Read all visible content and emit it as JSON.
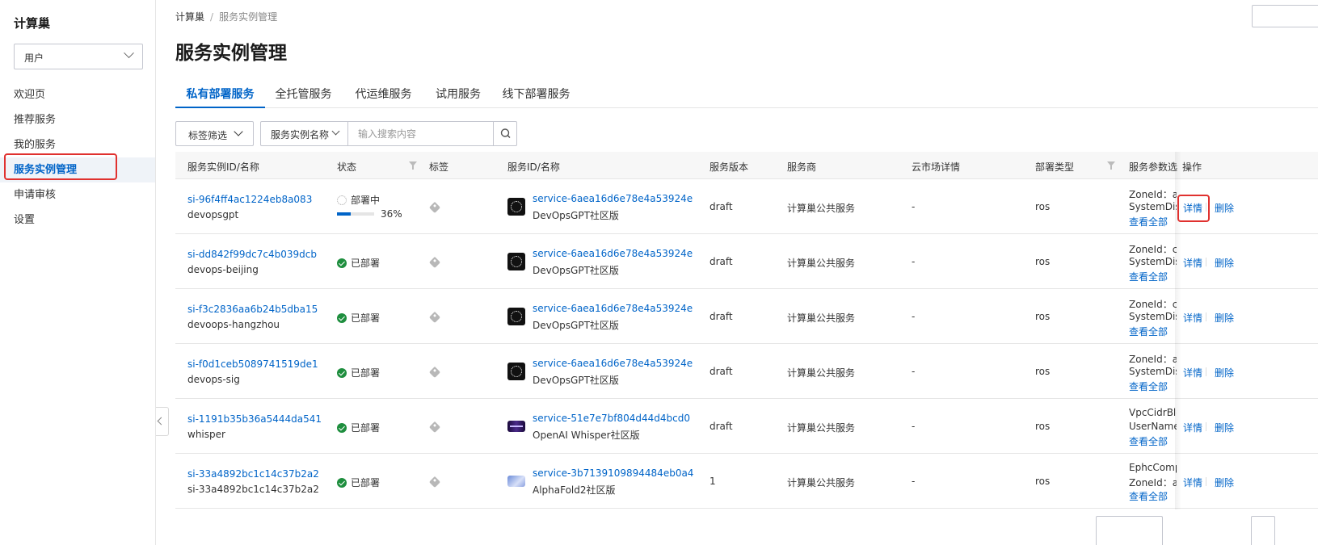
{
  "sidebar": {
    "brand": "计算巢",
    "role_select": "用户",
    "items": [
      {
        "label": "欢迎页"
      },
      {
        "label": "推荐服务"
      },
      {
        "label": "我的服务"
      },
      {
        "label": "服务实例管理"
      },
      {
        "label": "申请审核"
      },
      {
        "label": "设置"
      }
    ]
  },
  "breadcrumb": {
    "root": "计算巢",
    "separator": "/",
    "current": "服务实例管理"
  },
  "page_title": "服务实例管理",
  "tabs": [
    "私有部署服务",
    "全托管服务",
    "代运维服务",
    "试用服务",
    "线下部署服务"
  ],
  "filters": {
    "tag_filter": "标签筛选",
    "search_field": "服务实例名称",
    "search_placeholder": "输入搜索内容"
  },
  "table": {
    "columns": [
      "服务实例ID/名称",
      "状态",
      "标签",
      "服务ID/名称",
      "服务版本",
      "服务商",
      "云市场详情",
      "部署类型",
      "服务参数选",
      "操作"
    ],
    "actions": {
      "detail": "详情",
      "delete": "删除",
      "view_all": "查看全部"
    },
    "rows": [
      {
        "id": "si-96f4ff4ac1224eb8a083",
        "name": "devopsgpt",
        "status": "部署中",
        "progress": 36,
        "progress_label": "36%",
        "service_id": "service-6aea16d6e78e4a53924e",
        "service_name": "DevOpsGPT社区版",
        "logo": "gpt",
        "version": "draft",
        "provider": "计算巢公共服务",
        "market": "-",
        "deploy_type": "ros",
        "param1": "ZoneId：ap",
        "param2": "SystemDisk"
      },
      {
        "id": "si-dd842f99dc7c4b039dcb",
        "name": "devops-beijing",
        "status": "已部署",
        "service_id": "service-6aea16d6e78e4a53924e",
        "service_name": "DevOpsGPT社区版",
        "logo": "gpt",
        "version": "draft",
        "provider": "计算巢公共服务",
        "market": "-",
        "deploy_type": "ros",
        "param1": "ZoneId：cr",
        "param2": "SystemDisk"
      },
      {
        "id": "si-f3c2836aa6b24b5dba15",
        "name": "devoops-hangzhou",
        "status": "已部署",
        "service_id": "service-6aea16d6e78e4a53924e",
        "service_name": "DevOpsGPT社区版",
        "logo": "gpt",
        "version": "draft",
        "provider": "计算巢公共服务",
        "market": "-",
        "deploy_type": "ros",
        "param1": "ZoneId：cr",
        "param2": "SystemDisk"
      },
      {
        "id": "si-f0d1ceb5089741519de1",
        "name": "devops-sig",
        "status": "已部署",
        "service_id": "service-6aea16d6e78e4a53924e",
        "service_name": "DevOpsGPT社区版",
        "logo": "gpt",
        "version": "draft",
        "provider": "计算巢公共服务",
        "market": "-",
        "deploy_type": "ros",
        "param1": "ZoneId：ap",
        "param2": "SystemDisk"
      },
      {
        "id": "si-1191b35b36a5444da541",
        "name": "whisper",
        "status": "已部署",
        "service_id": "service-51e7e7bf804d44d4bcd0",
        "service_name": "OpenAI Whisper社区版",
        "logo": "whisper",
        "version": "draft",
        "provider": "计算巢公共服务",
        "market": "-",
        "deploy_type": "ros",
        "param1": "VpcCidrBlo",
        "param2": "UserName"
      },
      {
        "id": "si-33a4892bc1c14c37b2a2",
        "name": "si-33a4892bc1c14c37b2a2",
        "status": "已部署",
        "service_id": "service-3b7139109894484eb0a4",
        "service_name": "AlphaFold2社区版",
        "logo": "alpha",
        "version": "1",
        "provider": "计算巢公共服务",
        "market": "-",
        "deploy_type": "ros",
        "param1": "EphcComp",
        "param2": "ZoneId：ap"
      }
    ]
  }
}
